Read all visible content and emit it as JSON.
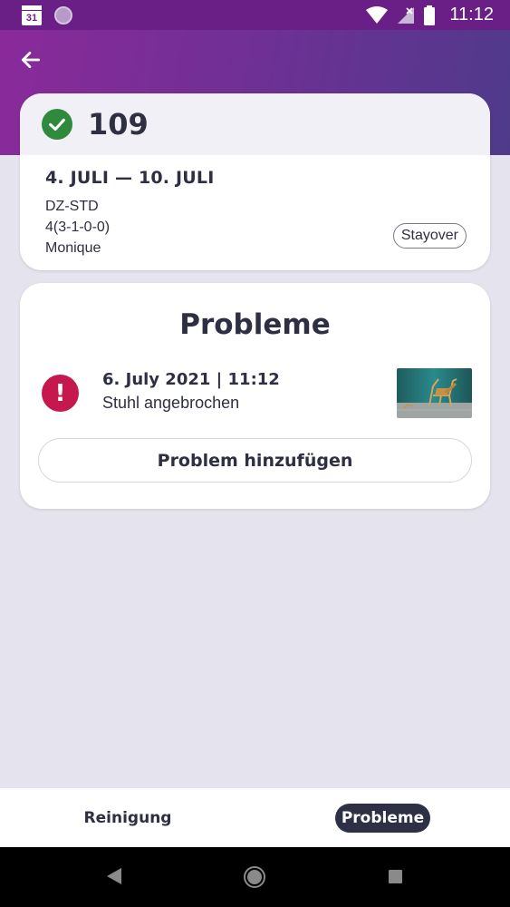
{
  "status_bar": {
    "calendar_day": "31",
    "time": "11:12",
    "icons": [
      "calendar-icon",
      "sync-icon",
      "wifi-icon",
      "signal-icon",
      "battery-icon"
    ]
  },
  "header": {
    "back_icon": "arrow-left-icon"
  },
  "room": {
    "number": "109",
    "status_icon": "check-circle-icon",
    "status_color": "#2f8a3c",
    "date_range": "4. JULI — 10. JULI",
    "room_type": "DZ-STD",
    "occupancy": "4(3-1-0-0)",
    "guest": "Monique",
    "badge": "Stayover"
  },
  "problems": {
    "title": "Probleme",
    "items": [
      {
        "date": "6. July 2021 | 11:12",
        "description": "Stuhl angebrochen",
        "icon": "alert-icon",
        "icon_color": "#c4184f"
      }
    ],
    "add_button": "Problem hinzufügen"
  },
  "tabs": [
    {
      "label": "Reinigung",
      "active": false
    },
    {
      "label": "Probleme",
      "active": true
    }
  ],
  "colors": {
    "header_gradient_start": "#8a2a9a",
    "header_gradient_end": "#4f3a8a",
    "background": "#e5e4ee",
    "active_tab": "#2e3146",
    "text": "#2e2f42"
  }
}
